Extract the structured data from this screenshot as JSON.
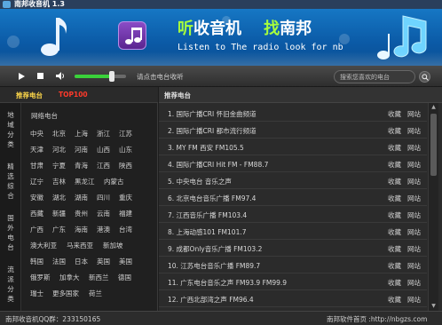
{
  "window": {
    "title": "南邦收音机 1.3"
  },
  "banner": {
    "slogan_part1_highlight": "听",
    "slogan_part1": "收音机",
    "slogan_part2_highlight": "找",
    "slogan_part2": "南邦",
    "subtitle": "Listen to The radio look for nb"
  },
  "controls": {
    "play_icon": "play-icon",
    "stop_icon": "stop-icon",
    "volume_icon": "speaker-icon",
    "volume_level": 0.72,
    "listen_link": "请点击电台收听",
    "search_placeholder": "搜索您喜欢的电台",
    "search_icon": "search-icon"
  },
  "left_panel": {
    "tabs": [
      {
        "label": "推荐电台",
        "color": "#ffd84a"
      },
      {
        "label": "TOP100",
        "color": "#ff3a2a"
      }
    ],
    "vnav": [
      {
        "label": "地域分类"
      },
      {
        "label": "精选综合"
      },
      {
        "label": "国外电台"
      },
      {
        "label": "流派分类"
      }
    ],
    "grid_title": "网络电台",
    "regions": [
      [
        "中央",
        "北京",
        "上海",
        "浙江",
        "江苏"
      ],
      [
        "天津",
        "河北",
        "河南",
        "山西",
        "山东"
      ],
      [
        "甘肃",
        "宁夏",
        "青海",
        "江西",
        "陕西"
      ],
      [
        "辽宁",
        "吉林",
        "黑龙江",
        "内蒙古"
      ],
      [
        "安徽",
        "湖北",
        "湖南",
        "四川",
        "重庆"
      ],
      [
        "西藏",
        "新疆",
        "贵州",
        "云南",
        "福建"
      ],
      [
        "广西",
        "广东",
        "海南",
        "港澳",
        "台湾"
      ],
      [
        "澳大利亚",
        "马来西亚",
        "新加坡"
      ],
      [
        "韩国",
        "法国",
        "日本",
        "英国",
        "美国"
      ],
      [
        "俄罗斯",
        "加拿大",
        "新西兰",
        "德国"
      ],
      [
        "瑞士",
        "更多国家",
        "荷兰"
      ]
    ]
  },
  "station_list": {
    "header": "推荐电台",
    "fav_label": "收藏",
    "site_label": "网站",
    "stations": [
      "1. 国际广播CRI 怀旧金曲频道",
      "2. 国际广播CRI 都市流行频道",
      "3. MY FM 西安 FM105.5",
      "4. 国际广播CRI Hit FM - FM88.7",
      "5. 中央电台 音乐之声",
      "6. 北京电台音乐广播 FM97.4",
      "7. 江西音乐广播 FM103.4",
      "8. 上海动感101 FM101.7",
      "9. 成都Only音乐广播 FM103.2",
      "10. 江苏电台音乐广播 FM89.7",
      "11. 广东电台音乐之声 FM93.9 FM99.9",
      "12. 广西北部湾之声 FM96.4"
    ]
  },
  "status_bar": {
    "left": "南邦收音机QQ群：233150165",
    "right": "南邦软件首页 :http://nbgzs.com"
  }
}
